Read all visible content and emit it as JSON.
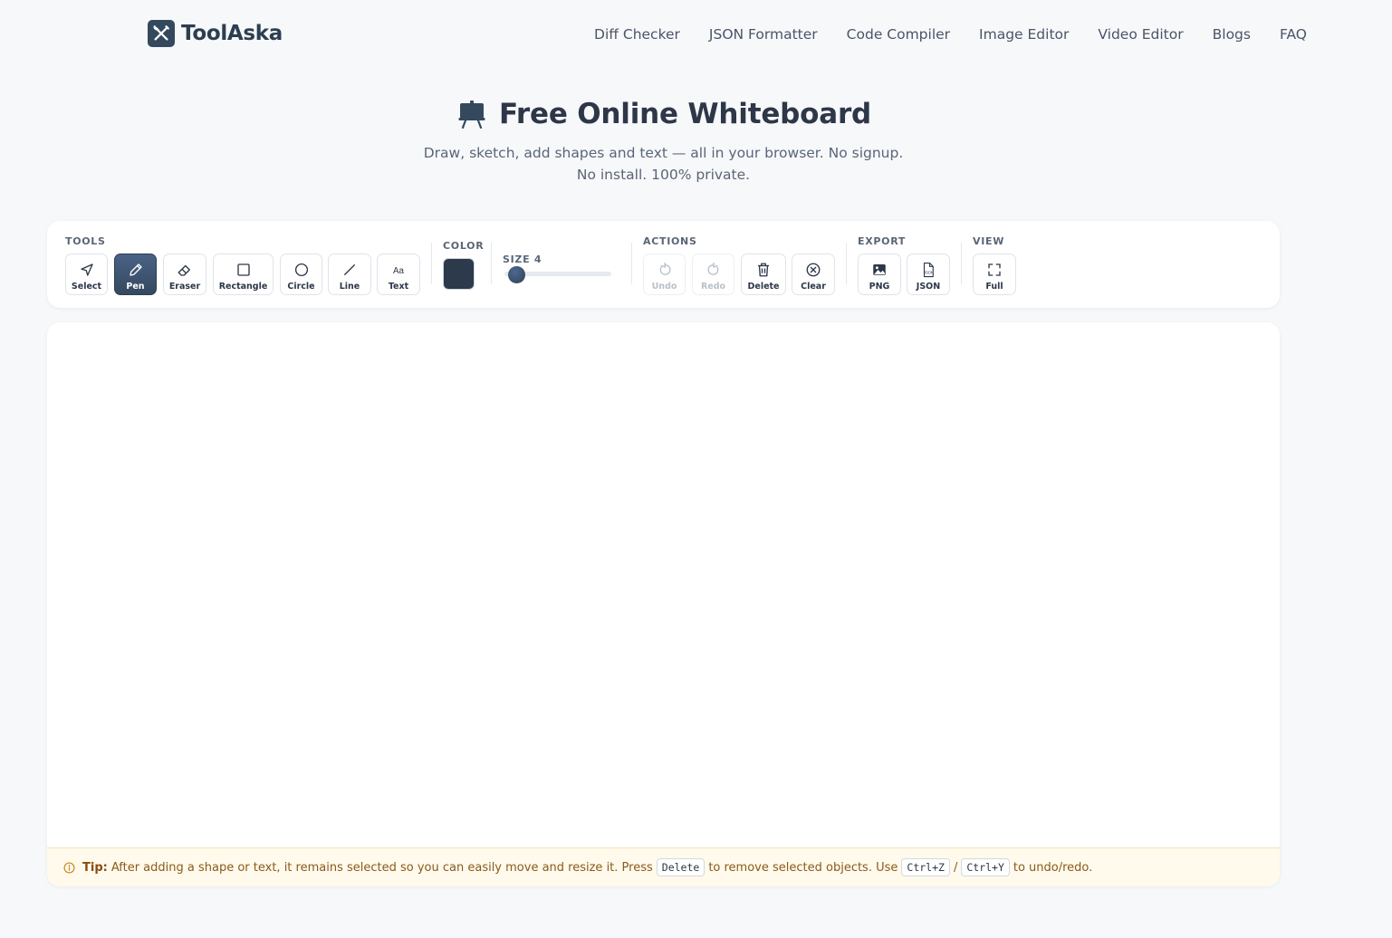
{
  "header": {
    "brand": "ToolAska",
    "nav": [
      "Diff Checker",
      "JSON Formatter",
      "Code Compiler",
      "Image Editor",
      "Video Editor",
      "Blogs",
      "FAQ"
    ]
  },
  "hero": {
    "title": "Free Online Whiteboard",
    "subtitle": "Draw, sketch, add shapes and text — all in your browser. No signup. No install. 100% private.",
    "icon": "easel-icon"
  },
  "toolbar": {
    "tools_label": "TOOLS",
    "tools": [
      {
        "label": "Select",
        "icon": "cursor-arrow-icon",
        "active": false
      },
      {
        "label": "Pen",
        "icon": "pencil-icon",
        "active": true
      },
      {
        "label": "Eraser",
        "icon": "eraser-icon",
        "active": false
      },
      {
        "label": "Rectangle",
        "icon": "rectangle-icon",
        "active": false
      },
      {
        "label": "Circle",
        "icon": "circle-icon",
        "active": false
      },
      {
        "label": "Line",
        "icon": "line-icon",
        "active": false
      },
      {
        "label": "Text",
        "icon": "text-icon",
        "active": false
      }
    ],
    "color_label": "COLOR",
    "color_value": "#2c3a4b",
    "size_label": "SIZE 4",
    "size_value": 4,
    "actions_label": "ACTIONS",
    "actions": [
      {
        "label": "Undo",
        "icon": "undo-icon",
        "disabled": true
      },
      {
        "label": "Redo",
        "icon": "redo-icon",
        "disabled": true
      },
      {
        "label": "Delete",
        "icon": "trash-icon",
        "disabled": false
      },
      {
        "label": "Clear",
        "icon": "clear-circle-icon",
        "disabled": false
      }
    ],
    "export_label": "EXPORT",
    "export": [
      {
        "label": "PNG",
        "icon": "image-icon"
      },
      {
        "label": "JSON",
        "icon": "json-file-icon",
        "icon_text": "JSON"
      }
    ],
    "view_label": "VIEW",
    "view": [
      {
        "label": "Full",
        "icon": "fullscreen-icon"
      }
    ]
  },
  "tip": {
    "icon": "info-icon",
    "label": "Tip:",
    "text1": "After adding a shape or text, it remains selected so you can easily move and resize it. Press",
    "key1": "Delete",
    "text2": "to remove selected objects. Use",
    "key2": "Ctrl+Z",
    "slash": "/",
    "key3": "Ctrl+Y",
    "text3": "to undo/redo."
  },
  "colors": {
    "primary": "#34495e",
    "tip_bg": "#fffaec",
    "tip_text": "#8a5a1a"
  }
}
